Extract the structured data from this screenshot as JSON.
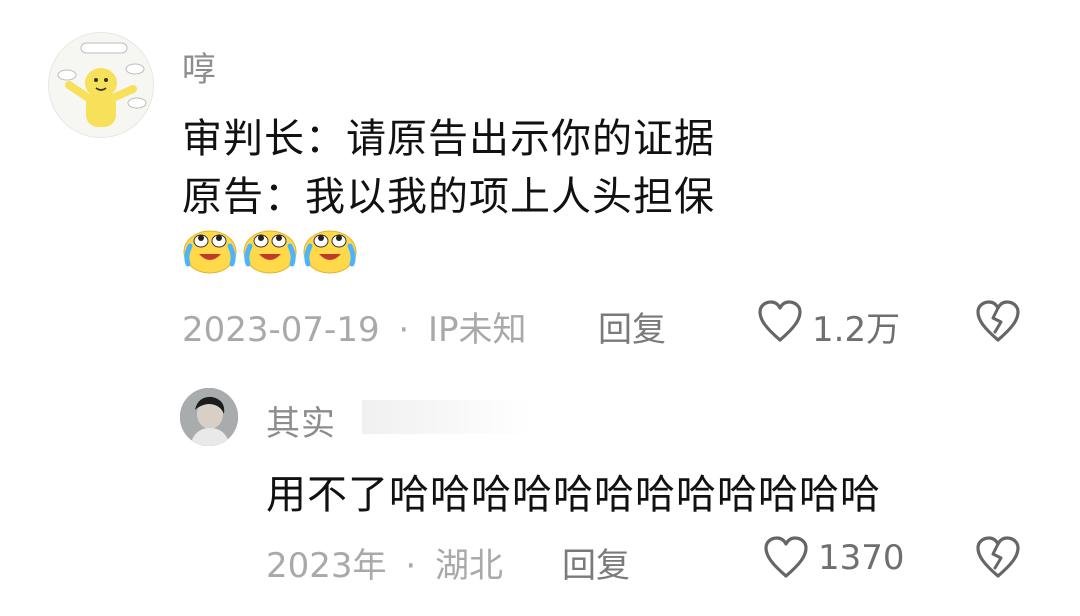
{
  "main_comment": {
    "username": "啍",
    "lines": [
      "审判长：请原告出示你的证据",
      "原告：我以我的项上人头担保"
    ],
    "emoji_names": [
      "crying-laughing-emoji",
      "crying-laughing-emoji",
      "crying-laughing-emoji"
    ],
    "date": "2023-07-19",
    "separator": "·",
    "location": "IP未知",
    "reply_label": "回复",
    "like_count": "1.2万"
  },
  "reply_comment": {
    "username": "其实",
    "text": "用不了哈哈哈哈哈哈哈哈哈哈哈哈",
    "date": "2023年",
    "separator": "·",
    "location": "湖北",
    "reply_label": "回复",
    "like_count": "1370"
  },
  "icons": {
    "like": "heart-outline-icon",
    "dislike": "broken-heart-icon"
  },
  "colors": {
    "text_primary": "#111111",
    "text_meta": "#a9a9a9",
    "username": "#8d8d8d",
    "avatar_bg": "#f4f4f1",
    "emoji_yellow": "#ffd94a"
  }
}
